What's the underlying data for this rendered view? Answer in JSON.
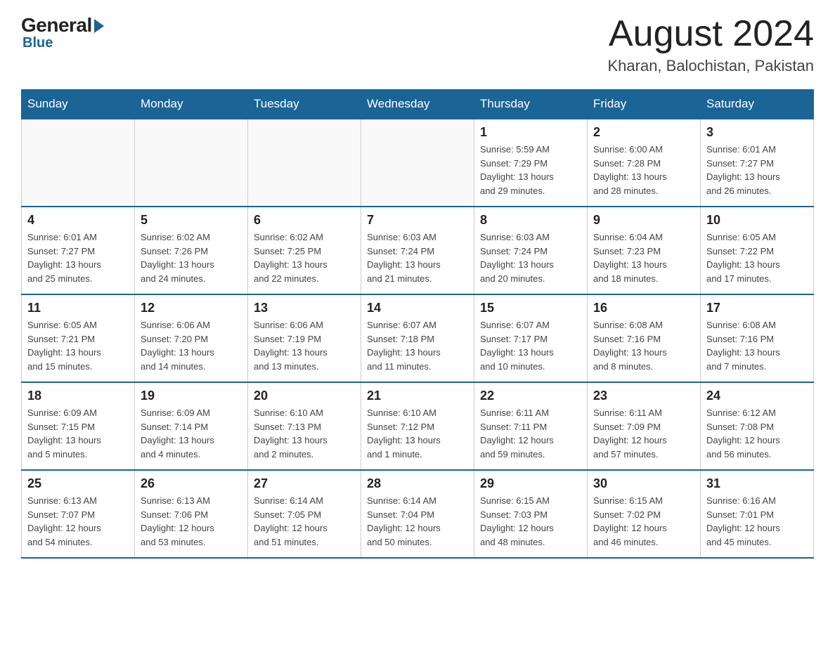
{
  "header": {
    "logo_general": "General",
    "logo_blue": "Blue",
    "month": "August 2024",
    "location": "Kharan, Balochistan, Pakistan"
  },
  "days_of_week": [
    "Sunday",
    "Monday",
    "Tuesday",
    "Wednesday",
    "Thursday",
    "Friday",
    "Saturday"
  ],
  "weeks": [
    [
      {
        "day": "",
        "info": ""
      },
      {
        "day": "",
        "info": ""
      },
      {
        "day": "",
        "info": ""
      },
      {
        "day": "",
        "info": ""
      },
      {
        "day": "1",
        "info": "Sunrise: 5:59 AM\nSunset: 7:29 PM\nDaylight: 13 hours\nand 29 minutes."
      },
      {
        "day": "2",
        "info": "Sunrise: 6:00 AM\nSunset: 7:28 PM\nDaylight: 13 hours\nand 28 minutes."
      },
      {
        "day": "3",
        "info": "Sunrise: 6:01 AM\nSunset: 7:27 PM\nDaylight: 13 hours\nand 26 minutes."
      }
    ],
    [
      {
        "day": "4",
        "info": "Sunrise: 6:01 AM\nSunset: 7:27 PM\nDaylight: 13 hours\nand 25 minutes."
      },
      {
        "day": "5",
        "info": "Sunrise: 6:02 AM\nSunset: 7:26 PM\nDaylight: 13 hours\nand 24 minutes."
      },
      {
        "day": "6",
        "info": "Sunrise: 6:02 AM\nSunset: 7:25 PM\nDaylight: 13 hours\nand 22 minutes."
      },
      {
        "day": "7",
        "info": "Sunrise: 6:03 AM\nSunset: 7:24 PM\nDaylight: 13 hours\nand 21 minutes."
      },
      {
        "day": "8",
        "info": "Sunrise: 6:03 AM\nSunset: 7:24 PM\nDaylight: 13 hours\nand 20 minutes."
      },
      {
        "day": "9",
        "info": "Sunrise: 6:04 AM\nSunset: 7:23 PM\nDaylight: 13 hours\nand 18 minutes."
      },
      {
        "day": "10",
        "info": "Sunrise: 6:05 AM\nSunset: 7:22 PM\nDaylight: 13 hours\nand 17 minutes."
      }
    ],
    [
      {
        "day": "11",
        "info": "Sunrise: 6:05 AM\nSunset: 7:21 PM\nDaylight: 13 hours\nand 15 minutes."
      },
      {
        "day": "12",
        "info": "Sunrise: 6:06 AM\nSunset: 7:20 PM\nDaylight: 13 hours\nand 14 minutes."
      },
      {
        "day": "13",
        "info": "Sunrise: 6:06 AM\nSunset: 7:19 PM\nDaylight: 13 hours\nand 13 minutes."
      },
      {
        "day": "14",
        "info": "Sunrise: 6:07 AM\nSunset: 7:18 PM\nDaylight: 13 hours\nand 11 minutes."
      },
      {
        "day": "15",
        "info": "Sunrise: 6:07 AM\nSunset: 7:17 PM\nDaylight: 13 hours\nand 10 minutes."
      },
      {
        "day": "16",
        "info": "Sunrise: 6:08 AM\nSunset: 7:16 PM\nDaylight: 13 hours\nand 8 minutes."
      },
      {
        "day": "17",
        "info": "Sunrise: 6:08 AM\nSunset: 7:16 PM\nDaylight: 13 hours\nand 7 minutes."
      }
    ],
    [
      {
        "day": "18",
        "info": "Sunrise: 6:09 AM\nSunset: 7:15 PM\nDaylight: 13 hours\nand 5 minutes."
      },
      {
        "day": "19",
        "info": "Sunrise: 6:09 AM\nSunset: 7:14 PM\nDaylight: 13 hours\nand 4 minutes."
      },
      {
        "day": "20",
        "info": "Sunrise: 6:10 AM\nSunset: 7:13 PM\nDaylight: 13 hours\nand 2 minutes."
      },
      {
        "day": "21",
        "info": "Sunrise: 6:10 AM\nSunset: 7:12 PM\nDaylight: 13 hours\nand 1 minute."
      },
      {
        "day": "22",
        "info": "Sunrise: 6:11 AM\nSunset: 7:11 PM\nDaylight: 12 hours\nand 59 minutes."
      },
      {
        "day": "23",
        "info": "Sunrise: 6:11 AM\nSunset: 7:09 PM\nDaylight: 12 hours\nand 57 minutes."
      },
      {
        "day": "24",
        "info": "Sunrise: 6:12 AM\nSunset: 7:08 PM\nDaylight: 12 hours\nand 56 minutes."
      }
    ],
    [
      {
        "day": "25",
        "info": "Sunrise: 6:13 AM\nSunset: 7:07 PM\nDaylight: 12 hours\nand 54 minutes."
      },
      {
        "day": "26",
        "info": "Sunrise: 6:13 AM\nSunset: 7:06 PM\nDaylight: 12 hours\nand 53 minutes."
      },
      {
        "day": "27",
        "info": "Sunrise: 6:14 AM\nSunset: 7:05 PM\nDaylight: 12 hours\nand 51 minutes."
      },
      {
        "day": "28",
        "info": "Sunrise: 6:14 AM\nSunset: 7:04 PM\nDaylight: 12 hours\nand 50 minutes."
      },
      {
        "day": "29",
        "info": "Sunrise: 6:15 AM\nSunset: 7:03 PM\nDaylight: 12 hours\nand 48 minutes."
      },
      {
        "day": "30",
        "info": "Sunrise: 6:15 AM\nSunset: 7:02 PM\nDaylight: 12 hours\nand 46 minutes."
      },
      {
        "day": "31",
        "info": "Sunrise: 6:16 AM\nSunset: 7:01 PM\nDaylight: 12 hours\nand 45 minutes."
      }
    ]
  ]
}
